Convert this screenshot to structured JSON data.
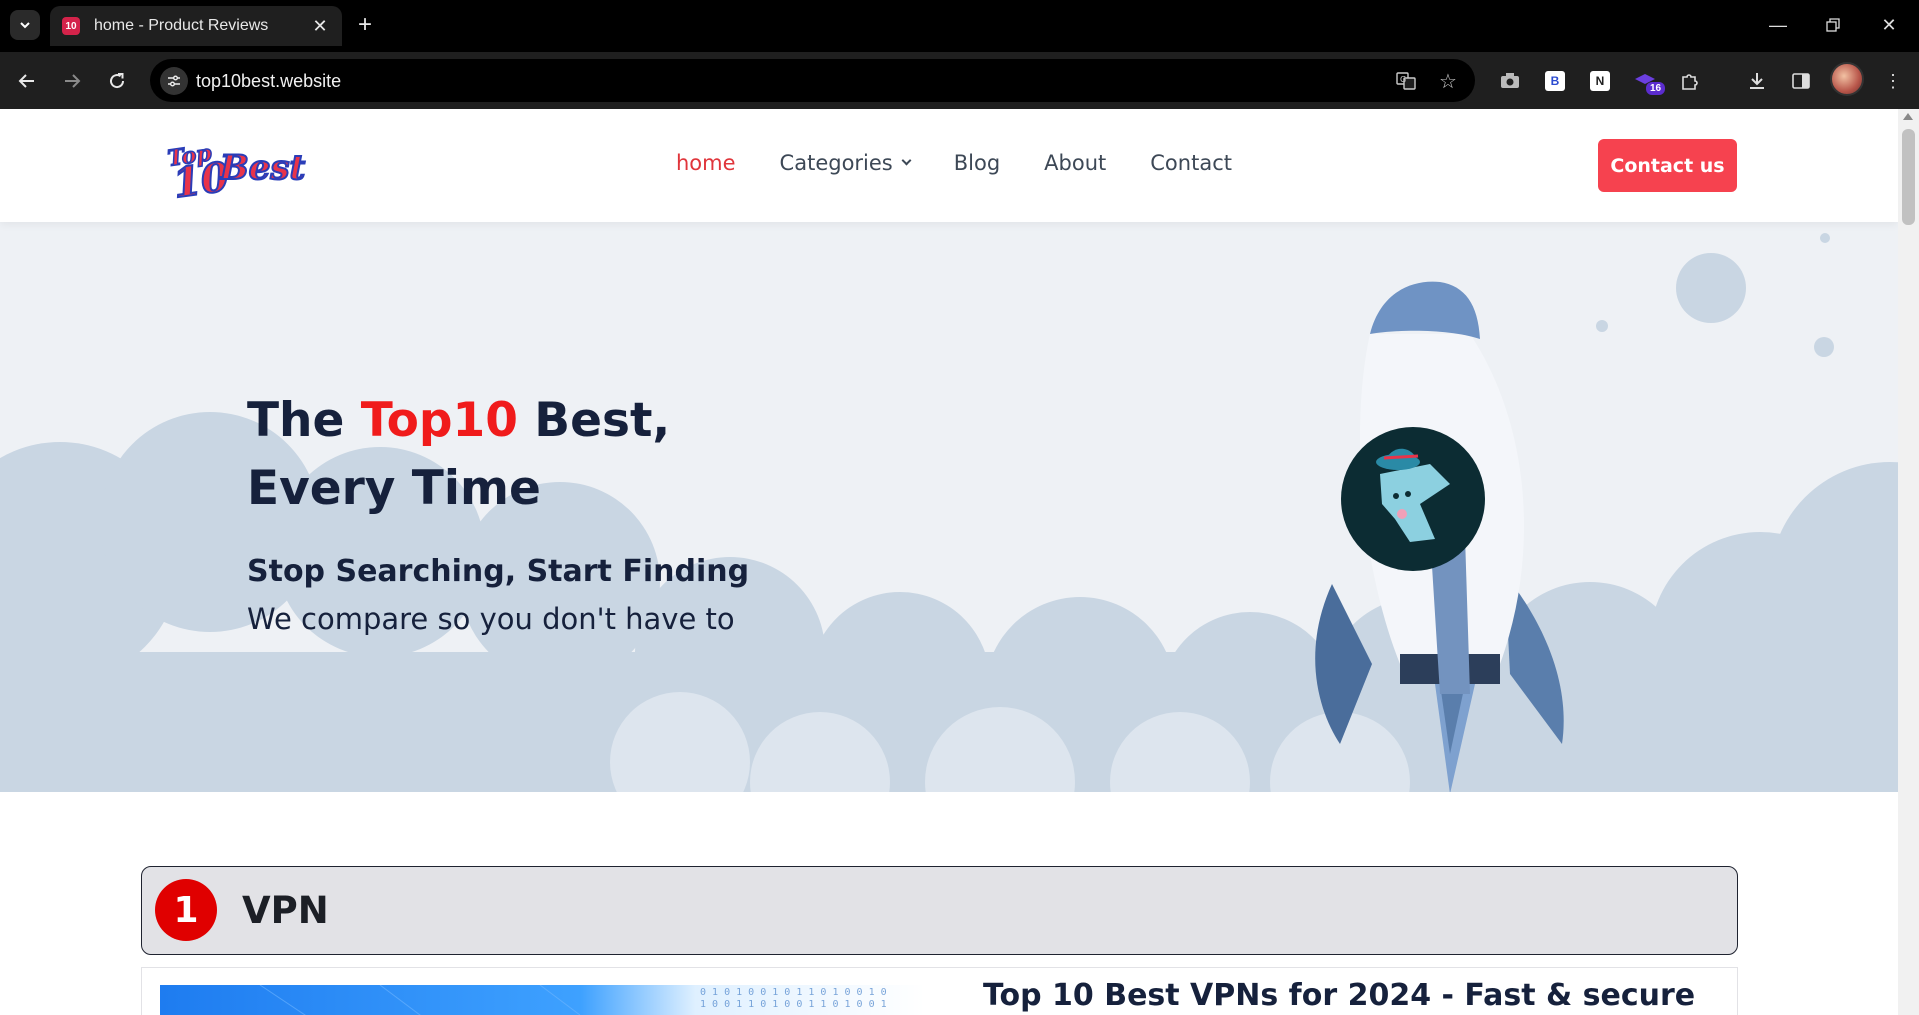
{
  "browser": {
    "tab_title": "home - Product Reviews",
    "url": "top10best.website",
    "extension_badge": "16",
    "ext_b_label": "B",
    "ext_n_label": "N"
  },
  "site": {
    "logo_alt": "Top 10 Best",
    "nav": [
      {
        "label": "home",
        "active": true
      },
      {
        "label": "Categories",
        "active": false
      },
      {
        "label": "Blog",
        "active": false
      },
      {
        "label": "About",
        "active": false
      },
      {
        "label": "Contact",
        "active": false
      }
    ],
    "cta_label": "Contact us",
    "accent": "#f6424f"
  },
  "hero": {
    "title_prefix": "The ",
    "title_highlight": "Top10",
    "title_suffix": " Best,",
    "title_line2": "Every Time",
    "subtitle": "Stop Searching, Start Finding",
    "subtitle2": "We compare so you don't have to"
  },
  "categories": [
    {
      "number": "1",
      "name": "VPN",
      "card_title": "Top 10 Best VPNs for 2024 - Fast & secure"
    }
  ]
}
